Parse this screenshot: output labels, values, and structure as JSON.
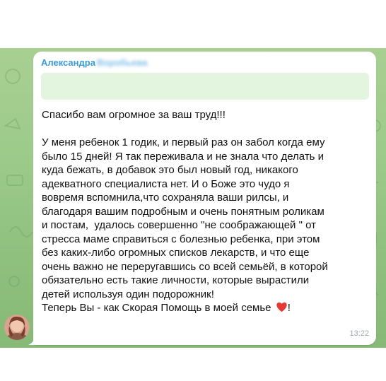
{
  "message": {
    "sender_first": "Александра",
    "sender_last_blurred": "Воробьева",
    "lines": [
      "Спасибо вам огромное за ваш труд!!!",
      "",
      "У меня ребенок 1 годик, и первый раз он забол когда ему",
      "было 15 дней! Я так переживала и не знала что делать и",
      "куда бежать, в добавок это был новый год, никакого",
      "адекватного специалиста нет. И о Боже это чудо я",
      "вовремя вспомнила,что сохраняла ваши рилсы, и",
      "благодаря вашим подробным и очень понятным роликам",
      "и постам,  удалось совершенно \"не соображающей \" от",
      "стресса маме справиться с болезнью ребенка, при этом",
      "без каких-либо огромных списков лекарств, и что еще",
      "очень важно не переругавшись со всей семьёй, в которой",
      "обязательно есть такие личности, которые вырастили",
      "детей используя один подорожник!"
    ],
    "last_line": "Теперь Вы - как Скорая Помощь в моей семье ",
    "last_line_end": "!",
    "time": "13:22"
  },
  "colors": {
    "sender": "#3a9ad9",
    "reply_box": "#e3f5df",
    "heart": "#e53935",
    "chat_bg": "#9ccb8a"
  },
  "icons": {
    "heart": "heart-emoji",
    "avatar": "user-avatar-photo"
  }
}
